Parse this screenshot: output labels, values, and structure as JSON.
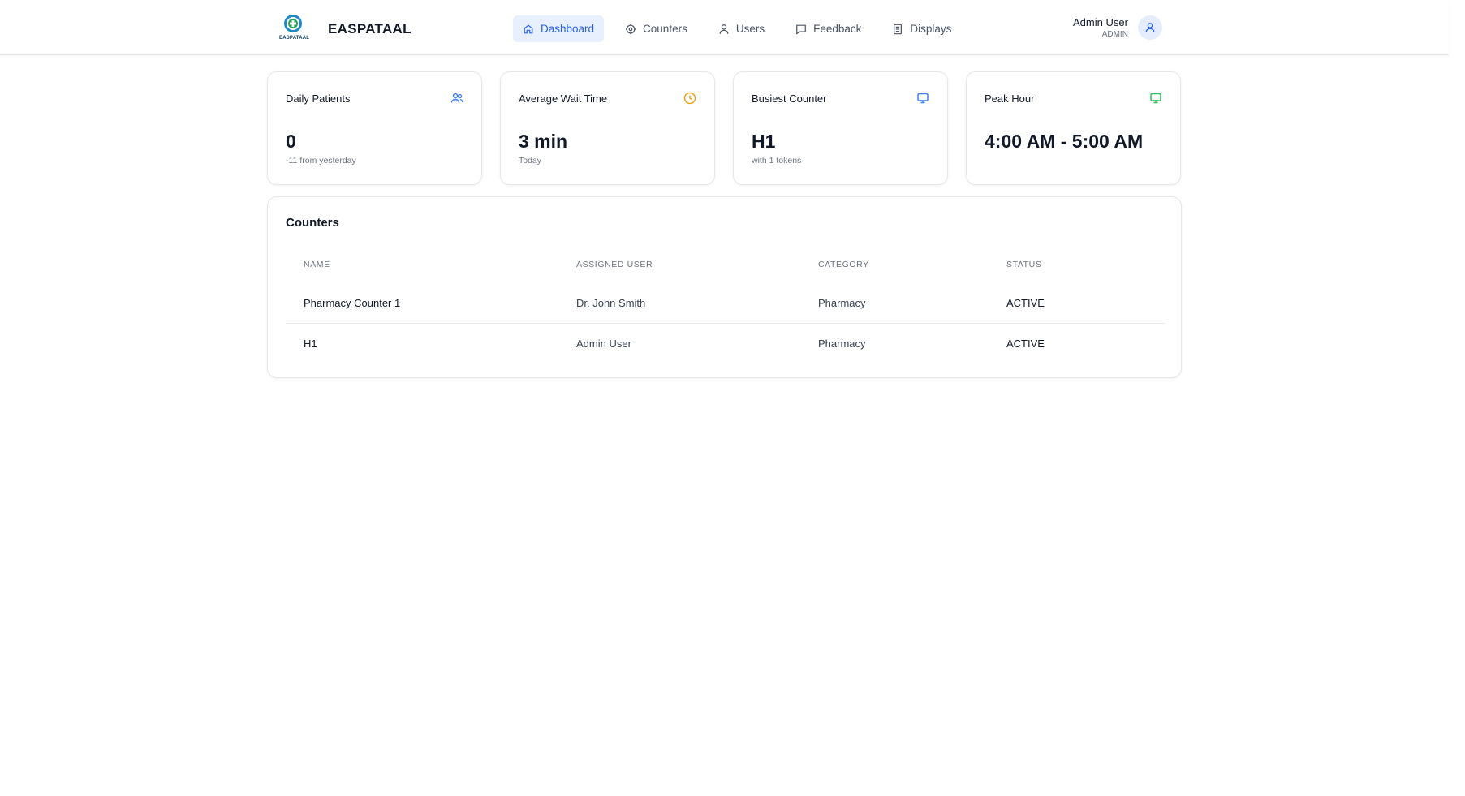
{
  "brand": {
    "name": "EASPATAAL",
    "logo_text": "EASPATAAL"
  },
  "nav": [
    {
      "label": "Dashboard",
      "icon": "home-icon",
      "active": true
    },
    {
      "label": "Counters",
      "icon": "gear-icon"
    },
    {
      "label": "Users",
      "icon": "user-icon"
    },
    {
      "label": "Feedback",
      "icon": "chat-icon"
    },
    {
      "label": "Displays",
      "icon": "display-list-icon"
    }
  ],
  "user": {
    "name": "Admin User",
    "role": "ADMIN",
    "icon": "user-icon"
  },
  "stats": [
    {
      "title": "Daily Patients",
      "value": "0",
      "sub": "-11 from yesterday",
      "icon": "users-icon",
      "color": "#3b82f6"
    },
    {
      "title": "Average Wait Time",
      "value": "3 min",
      "sub": "Today",
      "icon": "clock-icon",
      "color": "#f59e0b"
    },
    {
      "title": "Busiest Counter",
      "value": "H1",
      "sub": "with 1 tokens",
      "icon": "monitor-icon",
      "color": "#3b82f6"
    },
    {
      "title": "Peak Hour",
      "value": "4:00 AM - 5:00 AM",
      "sub": "",
      "icon": "monitor-icon",
      "color": "#22c55e"
    }
  ],
  "counters": {
    "title": "Counters",
    "columns": [
      "NAME",
      "ASSIGNED USER",
      "CATEGORY",
      "STATUS"
    ],
    "rows": [
      [
        "Pharmacy Counter 1",
        "Dr. John Smith",
        "Pharmacy",
        "ACTIVE"
      ],
      [
        "H1",
        "Admin User",
        "Pharmacy",
        "ACTIVE"
      ]
    ]
  },
  "colors": {
    "accent": "#2563eb",
    "accent_bg": "#e8f0fd"
  }
}
